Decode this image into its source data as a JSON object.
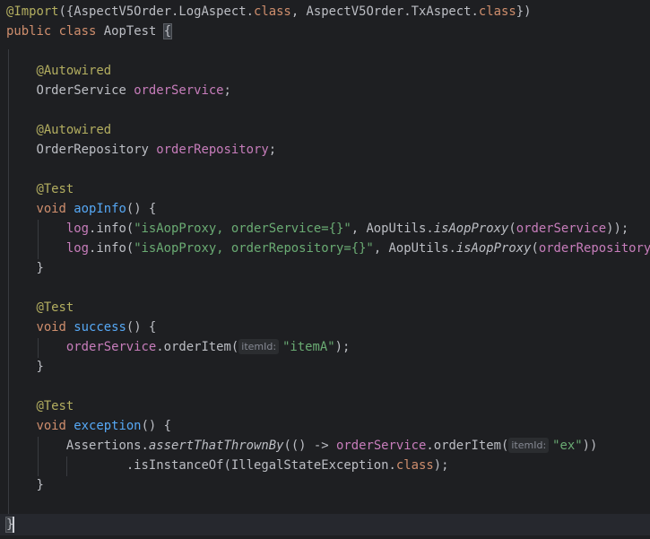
{
  "lines": {
    "l1": {
      "at": "@Import",
      "p1": "({AspectV5Order.LogAspect.",
      "kw1": "class",
      "p2": ", AspectV5Order.TxAspect.",
      "kw2": "class",
      "p3": "})"
    },
    "l2": {
      "kw_public": "public",
      "kw_class": "class",
      "name": "AopTest",
      "brace": "{"
    },
    "l4": {
      "ann": "@Autowired"
    },
    "l5": {
      "type": "OrderService",
      "field": "orderService",
      "semi": ";"
    },
    "l7": {
      "ann": "@Autowired"
    },
    "l8": {
      "type": "OrderRepository",
      "field": "orderRepository",
      "semi": ";"
    },
    "l10": {
      "ann": "@Test"
    },
    "l11": {
      "kw": "void",
      "method": "aopInfo",
      "rest": "() {"
    },
    "l12": {
      "log": "log",
      "info": ".info(",
      "str": "\"isAopProxy, orderService={}\"",
      "mid": ", AopUtils.",
      "call": "isAopProxy",
      "open": "(",
      "arg": "orderService",
      "close": "));"
    },
    "l13": {
      "log": "log",
      "info": ".info(",
      "str": "\"isAopProxy, orderRepository={}\"",
      "mid": ", AopUtils.",
      "call": "isAopProxy",
      "open": "(",
      "arg": "orderRepository",
      "close": "));"
    },
    "l14": {
      "brace": "}"
    },
    "l16": {
      "ann": "@Test"
    },
    "l17": {
      "kw": "void",
      "method": "success",
      "rest": "() {"
    },
    "l18": {
      "field": "orderService",
      "call": ".orderItem(",
      "hint": "itemId:",
      "str": "\"itemA\"",
      "close": ");"
    },
    "l19": {
      "brace": "}"
    },
    "l21": {
      "ann": "@Test"
    },
    "l22": {
      "kw": "void",
      "method": "exception",
      "rest": "() {"
    },
    "l23": {
      "cls": "Assertions.",
      "call": "assertThatThrownBy",
      "lambda": "(() -> ",
      "field": "orderService",
      "item": ".orderItem(",
      "hint": "itemId:",
      "str": "\"ex\"",
      "close": "))"
    },
    "l24": {
      "call": ".isInstanceOf(IllegalStateException.",
      "kw": "class",
      "close": ");"
    },
    "l25": {
      "brace": "}"
    },
    "l27": {
      "brace": "}"
    }
  },
  "colors": {
    "background": "#1e1f22",
    "text": "#bcbec4",
    "annotation": "#b3ae60",
    "keyword": "#cf8e6d",
    "field": "#c77dbb",
    "method_declaration": "#56a8f5",
    "string": "#6aab73",
    "inlay_hint": "#868993"
  }
}
